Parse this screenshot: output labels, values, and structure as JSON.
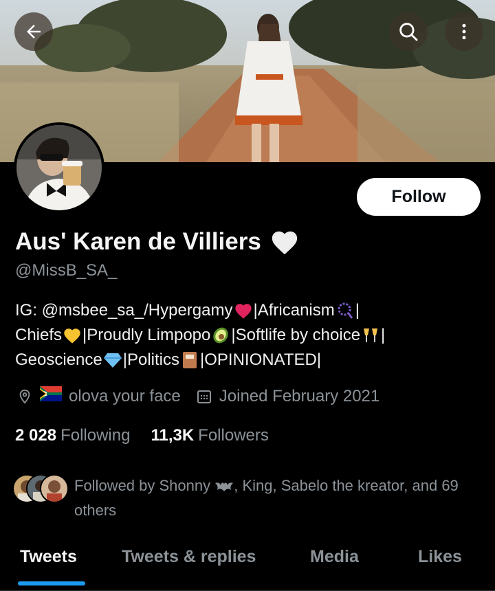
{
  "header": {
    "back_icon": "arrow-left-icon",
    "search_icon": "search-icon",
    "more_icon": "more-vertical-icon"
  },
  "profile": {
    "display_name": "Aus' Karen de Villiers",
    "name_emoji": "white-heart-icon",
    "handle": "@MissB_SA_",
    "follow_label": "Follow"
  },
  "bio": {
    "line1": {
      "a": "IG: @msbee_sa_/Hypergamy ",
      "b": "|Africanism",
      "c": "|"
    },
    "line2": {
      "a": "Chiefs",
      "b": "|Proudly Limpopo",
      "c": "|Softlife by choice",
      "d": "|"
    },
    "line3": {
      "a": "Geoscience",
      "b": "|Politics ",
      "c": " |OPINIONATED|"
    }
  },
  "meta": {
    "location": "olova your face",
    "joined": "Joined February 2021"
  },
  "stats": {
    "following_count": "2 028",
    "following_label": "Following",
    "followers_count": "11,3K",
    "followers_label": "Followers"
  },
  "followed_by": {
    "part1": "Followed by Shonny ",
    "part2": ", King, Sabelo the kreator, and 69 others"
  },
  "tabs": [
    "Tweets",
    "Tweets & replies",
    "Media",
    "Likes"
  ],
  "colors": {
    "accent": "#1d9bf0",
    "background": "#000000",
    "muted_text": "#8b9298"
  }
}
